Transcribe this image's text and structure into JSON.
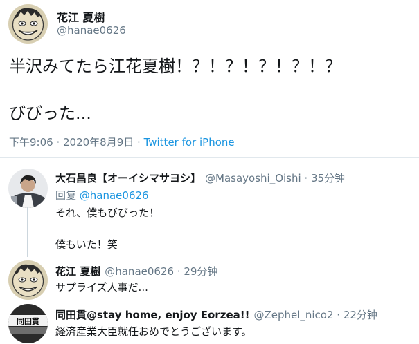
{
  "main": {
    "name": "花江 夏樹",
    "handle": "@hanae0626",
    "text_line1": "半沢みてたら江花夏樹！？！？！？！？！？",
    "text_line2": "びびった...",
    "time": "下午9:06 · 2020年8月9日 · ",
    "source": "Twitter for iPhone"
  },
  "replies": [
    {
      "name": "大石昌良【オーイシマサヨシ】",
      "handle": "@Masayoshi_Oishi · 35分钟",
      "reply_prefix": "回复 ",
      "reply_to": "@hanae0626",
      "line1": "それ、僕もびびった！",
      "line2": "僕もいた！笑"
    },
    {
      "name": "花江 夏樹",
      "handle": "@hanae0626 · 29分钟",
      "line1": "サプライズ人事だ..."
    },
    {
      "name": "同田貫@stay home, enjoy Eorzea!!",
      "handle": "@Zephel_nico2 · 22分钟",
      "line1": "経済産業大臣就任おめでとうございます。",
      "avatar_text": "同田貫"
    }
  ]
}
